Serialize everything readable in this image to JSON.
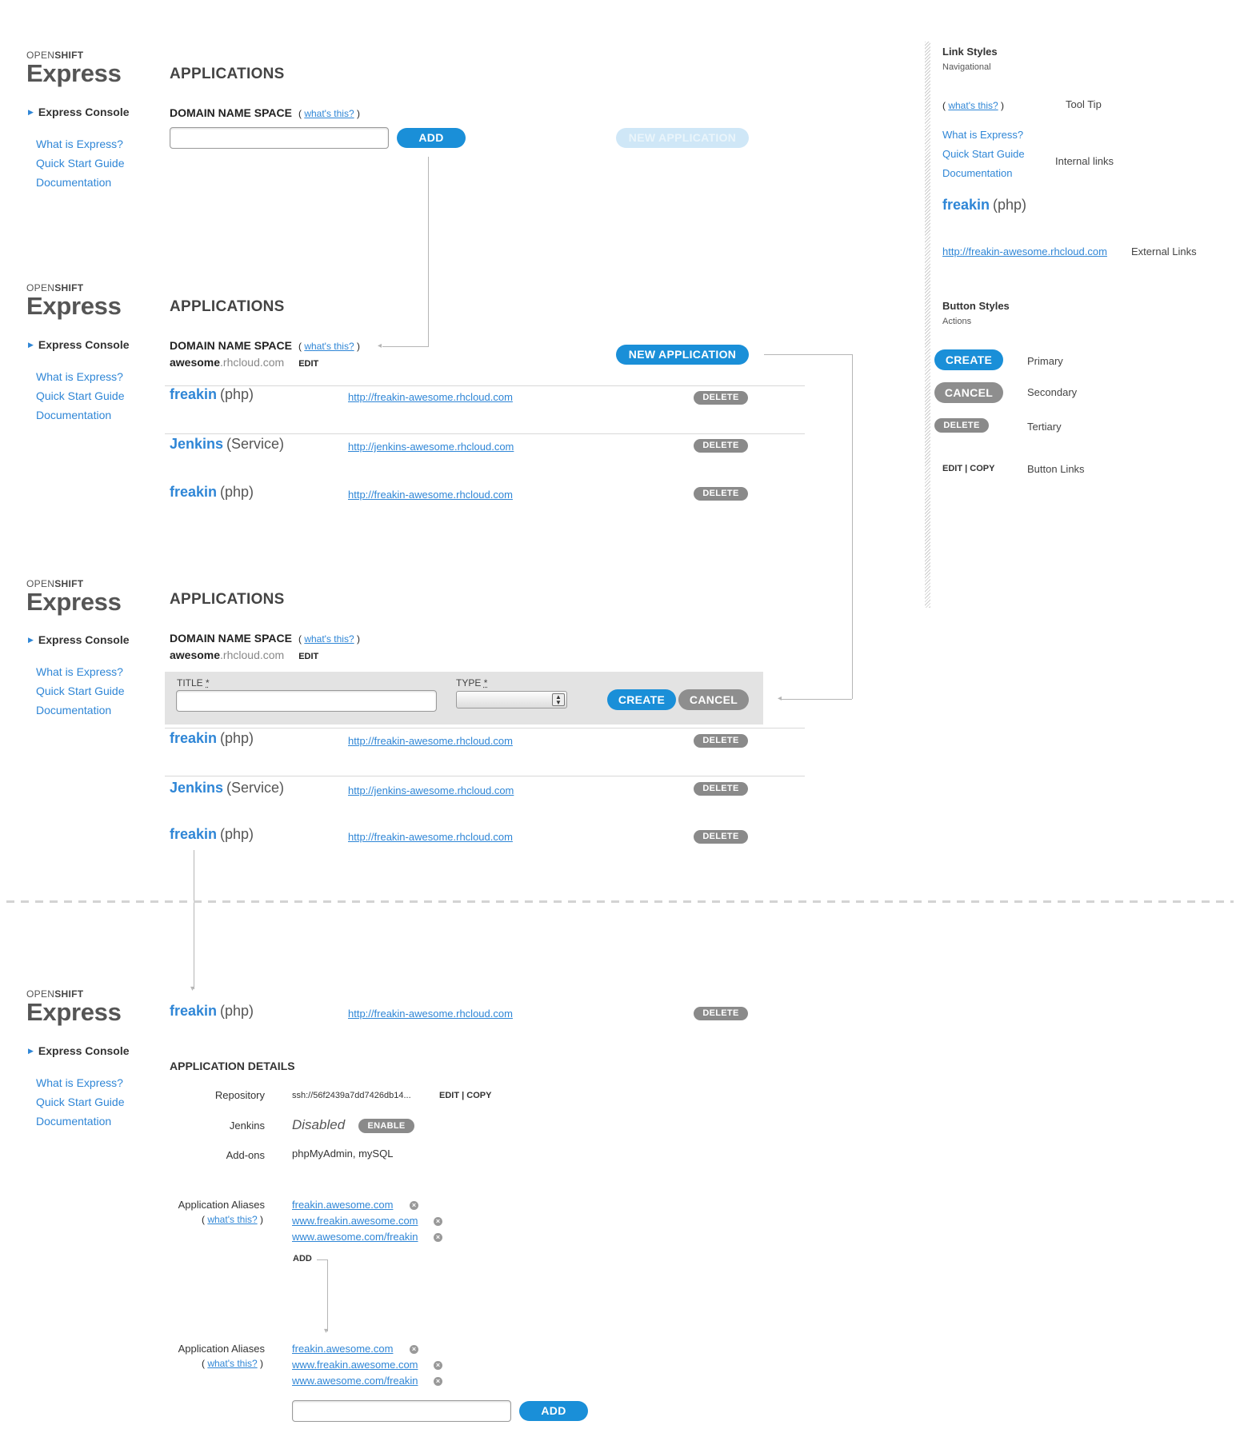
{
  "brand": {
    "top_a": "OPEN",
    "top_b": "SHIFT",
    "name": "Express"
  },
  "nav": {
    "console": "Express Console",
    "links": [
      "What is Express?",
      "Quick Start Guide",
      "Documentation"
    ]
  },
  "apps_heading": "APPLICATIONS",
  "dns": {
    "label": "DOMAIN NAME SPACE",
    "paren_open": "(",
    "whats": "what's this?",
    "paren_close": ")",
    "domain_bold": "awesome",
    "domain_suffix": ".rhcloud.com",
    "edit": "EDIT"
  },
  "buttons": {
    "add": "ADD",
    "new_app": "NEW APPLICATION",
    "create": "CREATE",
    "cancel": "CANCEL",
    "delete": "DELETE",
    "enable": "ENABLE"
  },
  "apps": [
    {
      "name": "freakin",
      "type": "(php)",
      "url": "http://freakin-awesome.rhcloud.com"
    },
    {
      "name": "Jenkins",
      "type": "(Service)",
      "url": "http://jenkins-awesome.rhcloud.com"
    },
    {
      "name": "freakin",
      "type": "(php)",
      "url": "http://freakin-awesome.rhcloud.com"
    }
  ],
  "form": {
    "title_label": "TITLE",
    "type_label": "TYPE",
    "required": "*"
  },
  "sidebar": {
    "link_styles": "Link Styles",
    "navigational": "Navigational",
    "tooltip": "Tool Tip",
    "internal": "Internal links",
    "external_url": "http://freakin-awesome.rhcloud.com",
    "external": "External Links",
    "button_styles": "Button Styles",
    "actions": "Actions",
    "primary": "Primary",
    "secondary": "Secondary",
    "tertiary": "Tertiary",
    "edit_copy": "EDIT | COPY",
    "button_links": "Button Links",
    "sample_name": "freakin",
    "sample_type": "(php)"
  },
  "details": {
    "heading": "APPLICATION DETAILS",
    "repo_label": "Repository",
    "repo_value": "ssh://56f2439a7dd7426db14...",
    "edit_copy": "EDIT | COPY",
    "jenkins_label": "Jenkins",
    "jenkins_value": "Disabled",
    "addons_label": "Add-ons",
    "addons_value": "phpMyAdmin, mySQL",
    "aliases_label": "Application Aliases",
    "aliases": [
      "freakin.awesome.com",
      "www.freakin.awesome.com",
      "www.awesome.com/freakin"
    ],
    "add": "ADD"
  }
}
